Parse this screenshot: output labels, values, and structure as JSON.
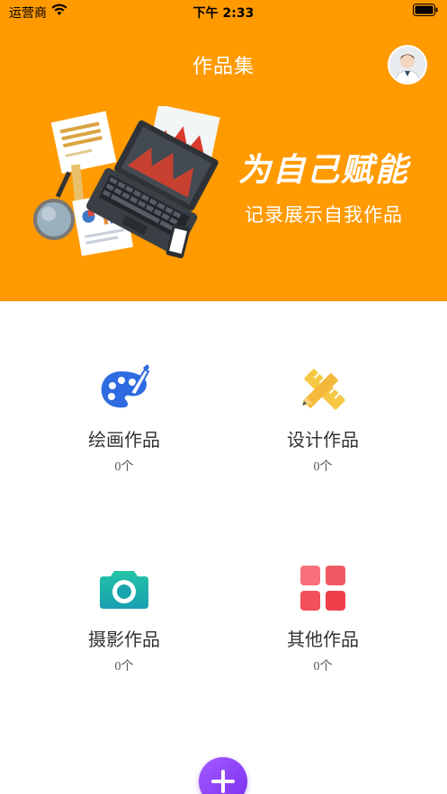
{
  "status_bar": {
    "carrier": "运营商",
    "time": "下午 2:33",
    "wifi_icon": "wifi-icon",
    "battery_icon": "battery-icon"
  },
  "header": {
    "title": "作品集",
    "avatar_icon": "user-avatar-icon",
    "background_color": "#FF9A00"
  },
  "banner": {
    "slogan": "为自己赋能",
    "subtitle": "记录展示自我作品",
    "illustration": "laptop-desk-illustration"
  },
  "categories": [
    {
      "label": "绘画作品",
      "count": "0个",
      "icon": "palette-icon",
      "color": "#2F6BE0"
    },
    {
      "label": "设计作品",
      "count": "0个",
      "icon": "ruler-pencil-icon",
      "color": "#F6C744"
    },
    {
      "label": "摄影作品",
      "count": "0个",
      "icon": "camera-icon",
      "color": "#1FB3A6"
    },
    {
      "label": "其他作品",
      "count": "0个",
      "icon": "grid-icon",
      "color": "#F2505B"
    }
  ],
  "fab": {
    "icon": "plus-icon",
    "color": "#8C3DF5"
  }
}
